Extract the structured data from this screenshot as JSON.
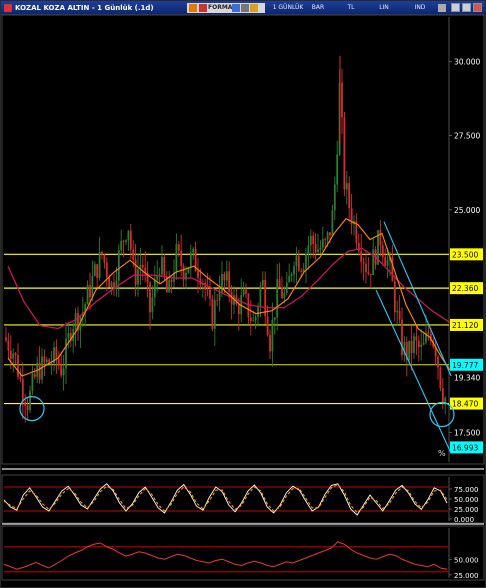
{
  "window": {
    "title": "KOZAL KOZA ALTIN - 1 Günlük (.1d)",
    "toolbar": [
      "FORMAS",
      "1 GÜNLÜK",
      "BAR",
      "TL",
      "LIN",
      "IND"
    ]
  },
  "colors": {
    "background": "#000000",
    "level_line": "#ffff00",
    "level_label_bg": "#ffff00",
    "cyan_label_bg": "#00ffff",
    "ma_short": "#ff8c00",
    "ma_long": "#c2185b",
    "channel": "#2ec8ff",
    "candle_up": "#2e7d32",
    "candle_down": "#d32f2f",
    "osc_line": "#ffffff",
    "osc_dash": "#ff9800",
    "rsi_line": "#e53935",
    "osc_band": "#8b0000"
  },
  "chart_data": [
    {
      "type": "candlestick",
      "title": "KOZAL KOZA ALTIN - 1 Günlük (.1d)",
      "ylim": [
        16.5,
        31.5
      ],
      "y_ticks": [
        "30.000",
        "27.500",
        "25.000",
        "17.500"
      ],
      "price_path": [
        [
          0,
          20.7
        ],
        [
          10,
          20.2
        ],
        [
          18,
          19.0
        ],
        [
          24,
          18.5
        ],
        [
          33,
          19.6
        ],
        [
          42,
          19.8
        ],
        [
          52,
          20.0
        ],
        [
          58,
          19.6
        ],
        [
          68,
          21.2
        ],
        [
          78,
          21.5
        ],
        [
          90,
          22.8
        ],
        [
          98,
          23.5
        ],
        [
          108,
          22.4
        ],
        [
          116,
          23.6
        ],
        [
          124,
          24.6
        ],
        [
          130,
          22.7
        ],
        [
          138,
          23.3
        ],
        [
          146,
          21.6
        ],
        [
          156,
          23.3
        ],
        [
          164,
          22.0
        ],
        [
          172,
          23.5
        ],
        [
          180,
          23.0
        ],
        [
          188,
          23.4
        ],
        [
          198,
          22.8
        ],
        [
          208,
          21.3
        ],
        [
          216,
          22.6
        ],
        [
          224,
          22.5
        ],
        [
          232,
          21.7
        ],
        [
          240,
          22.0
        ],
        [
          250,
          21.1
        ],
        [
          258,
          22.7
        ],
        [
          266,
          20.6
        ],
        [
          274,
          22.4
        ],
        [
          282,
          22.0
        ],
        [
          290,
          23.5
        ],
        [
          298,
          23.2
        ],
        [
          306,
          24.0
        ],
        [
          314,
          23.7
        ],
        [
          322,
          23.8
        ],
        [
          328,
          24.6
        ],
        [
          332,
          26.4
        ],
        [
          336,
          29.4
        ],
        [
          340,
          26.0
        ],
        [
          346,
          25.0
        ],
        [
          352,
          24.3
        ],
        [
          358,
          23.6
        ],
        [
          364,
          22.9
        ],
        [
          370,
          23.4
        ],
        [
          376,
          24.1
        ],
        [
          380,
          23.6
        ],
        [
          386,
          23.0
        ],
        [
          392,
          21.6
        ],
        [
          398,
          20.4
        ],
        [
          404,
          20.1
        ],
        [
          410,
          20.5
        ],
        [
          418,
          20.2
        ],
        [
          426,
          21.0
        ],
        [
          432,
          20.3
        ],
        [
          438,
          18.9
        ],
        [
          442,
          18.6
        ]
      ],
      "ma_short": [
        [
          4,
          20.0
        ],
        [
          18,
          19.4
        ],
        [
          34,
          19.6
        ],
        [
          54,
          20.0
        ],
        [
          72,
          20.9
        ],
        [
          92,
          22.3
        ],
        [
          110,
          22.9
        ],
        [
          126,
          23.3
        ],
        [
          140,
          22.9
        ],
        [
          156,
          22.5
        ],
        [
          172,
          22.9
        ],
        [
          190,
          23.1
        ],
        [
          204,
          22.7
        ],
        [
          220,
          22.3
        ],
        [
          236,
          21.8
        ],
        [
          252,
          21.5
        ],
        [
          268,
          21.6
        ],
        [
          284,
          22.0
        ],
        [
          300,
          22.9
        ],
        [
          316,
          23.4
        ],
        [
          330,
          24.2
        ],
        [
          342,
          24.7
        ],
        [
          354,
          24.5
        ],
        [
          366,
          24.0
        ],
        [
          378,
          24.2
        ],
        [
          390,
          23.0
        ],
        [
          402,
          21.8
        ],
        [
          414,
          21.0
        ],
        [
          426,
          20.7
        ],
        [
          438,
          20.0
        ],
        [
          446,
          19.6
        ]
      ],
      "ma_long": [
        [
          4,
          23.1
        ],
        [
          20,
          21.9
        ],
        [
          36,
          21.1
        ],
        [
          54,
          21.0
        ],
        [
          72,
          21.3
        ],
        [
          92,
          21.9
        ],
        [
          112,
          22.4
        ],
        [
          130,
          22.8
        ],
        [
          150,
          22.8
        ],
        [
          170,
          22.7
        ],
        [
          188,
          22.7
        ],
        [
          206,
          22.4
        ],
        [
          224,
          22.1
        ],
        [
          244,
          21.8
        ],
        [
          262,
          21.7
        ],
        [
          280,
          21.7
        ],
        [
          298,
          22.1
        ],
        [
          316,
          22.7
        ],
        [
          330,
          23.2
        ],
        [
          344,
          23.6
        ],
        [
          358,
          23.7
        ],
        [
          372,
          23.4
        ],
        [
          386,
          22.9
        ],
        [
          400,
          22.4
        ],
        [
          414,
          22.0
        ],
        [
          428,
          21.6
        ],
        [
          446,
          21.2
        ]
      ],
      "levels": [
        {
          "value": 23.5,
          "label": "23.500",
          "color": "yellow"
        },
        {
          "value": 22.36,
          "label": "22.360",
          "color": "yellow"
        },
        {
          "value": 21.12,
          "label": "21.120",
          "color": "yellow"
        },
        {
          "value": 19.777,
          "label": "19.777",
          "color": "cyan"
        },
        {
          "value": 18.47,
          "label": "18.470",
          "color": "yellow"
        },
        {
          "value": 16.993,
          "label": "16.993",
          "color": "cyan"
        }
      ],
      "side_values": [
        {
          "value": 19.34,
          "label": "19.340"
        }
      ],
      "channel_lines": [
        [
          [
            380,
            24.6
          ],
          [
            447,
            19.4
          ]
        ],
        [
          [
            372,
            22.3
          ],
          [
            447,
            16.8
          ]
        ]
      ],
      "circles": [
        {
          "x": 28,
          "y": 18.3
        },
        {
          "x": 438,
          "y": 18.1
        }
      ],
      "annotations": [
        "%"
      ]
    },
    {
      "type": "line",
      "title": "",
      "ylim": [
        -5,
        105
      ],
      "y_ticks": [
        "75.000",
        "50.000",
        "25.000",
        "0.000"
      ],
      "bands": [
        80,
        20
      ],
      "series": [
        {
          "values": [
            48,
            30,
            22,
            60,
            78,
            55,
            30,
            20,
            45,
            70,
            82,
            60,
            35,
            25,
            50,
            75,
            88,
            70,
            40,
            20,
            38,
            66,
            80,
            55,
            28,
            15,
            42,
            72,
            86,
            62,
            32,
            22,
            55,
            80,
            68,
            35,
            18,
            40,
            70,
            85,
            65,
            30,
            15,
            35,
            66,
            82,
            72,
            45,
            20,
            30,
            62,
            84,
            88,
            60,
            25,
            10,
            35,
            60,
            40,
            20,
            45,
            72,
            84,
            65,
            38,
            24,
            48,
            78,
            70,
            40
          ]
        },
        {
          "values": [
            45,
            34,
            26,
            50,
            70,
            60,
            38,
            24,
            40,
            62,
            76,
            65,
            42,
            28,
            44,
            68,
            82,
            74,
            48,
            26,
            34,
            58,
            76,
            62,
            36,
            20,
            36,
            64,
            80,
            68,
            40,
            25,
            46,
            72,
            72,
            44,
            24,
            34,
            62,
            80,
            70,
            38,
            20,
            30,
            58,
            76,
            76,
            52,
            28,
            28,
            54,
            78,
            86,
            68,
            34,
            16,
            30,
            54,
            46,
            26,
            38,
            64,
            80,
            70,
            44,
            28,
            42,
            70,
            72,
            48
          ]
        }
      ]
    },
    {
      "type": "line",
      "title": "",
      "ylim": [
        20,
        100
      ],
      "y_ticks": [
        "50.000",
        "25.000"
      ],
      "bands": [
        70,
        30
      ],
      "series": [
        {
          "values": [
            42,
            38,
            34,
            37,
            41,
            45,
            40,
            36,
            42,
            48,
            55,
            60,
            64,
            70,
            74,
            76,
            70,
            66,
            60,
            55,
            58,
            62,
            60,
            56,
            52,
            50,
            54,
            58,
            56,
            52,
            48,
            46,
            44,
            48,
            50,
            46,
            42,
            40,
            44,
            47,
            44,
            40,
            38,
            42,
            46,
            44,
            48,
            52,
            56,
            60,
            64,
            68,
            78,
            74,
            66,
            60,
            56,
            52,
            50,
            54,
            58,
            56,
            50,
            46,
            42,
            40,
            38,
            42,
            36,
            34
          ]
        }
      ]
    }
  ]
}
